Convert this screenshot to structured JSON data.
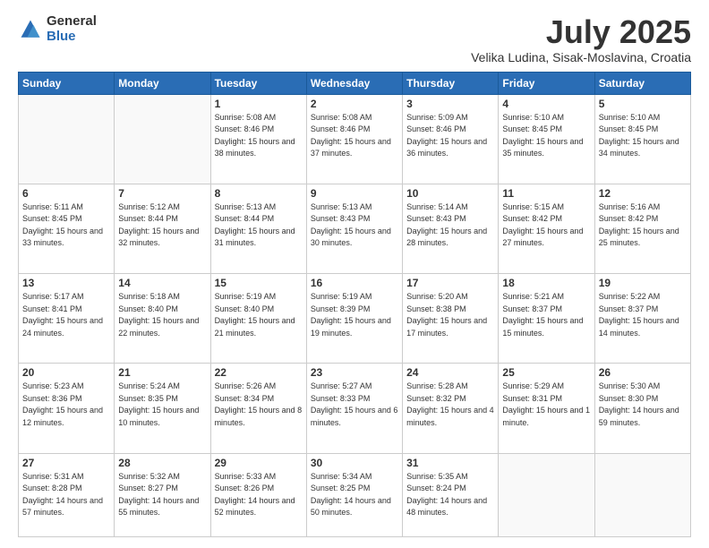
{
  "header": {
    "logo_general": "General",
    "logo_blue": "Blue",
    "month_title": "July 2025",
    "subtitle": "Velika Ludina, Sisak-Moslavina, Croatia"
  },
  "days_of_week": [
    "Sunday",
    "Monday",
    "Tuesday",
    "Wednesday",
    "Thursday",
    "Friday",
    "Saturday"
  ],
  "weeks": [
    [
      {
        "day": "",
        "sunrise": "",
        "sunset": "",
        "daylight": ""
      },
      {
        "day": "",
        "sunrise": "",
        "sunset": "",
        "daylight": ""
      },
      {
        "day": "1",
        "sunrise": "Sunrise: 5:08 AM",
        "sunset": "Sunset: 8:46 PM",
        "daylight": "Daylight: 15 hours and 38 minutes."
      },
      {
        "day": "2",
        "sunrise": "Sunrise: 5:08 AM",
        "sunset": "Sunset: 8:46 PM",
        "daylight": "Daylight: 15 hours and 37 minutes."
      },
      {
        "day": "3",
        "sunrise": "Sunrise: 5:09 AM",
        "sunset": "Sunset: 8:46 PM",
        "daylight": "Daylight: 15 hours and 36 minutes."
      },
      {
        "day": "4",
        "sunrise": "Sunrise: 5:10 AM",
        "sunset": "Sunset: 8:45 PM",
        "daylight": "Daylight: 15 hours and 35 minutes."
      },
      {
        "day": "5",
        "sunrise": "Sunrise: 5:10 AM",
        "sunset": "Sunset: 8:45 PM",
        "daylight": "Daylight: 15 hours and 34 minutes."
      }
    ],
    [
      {
        "day": "6",
        "sunrise": "Sunrise: 5:11 AM",
        "sunset": "Sunset: 8:45 PM",
        "daylight": "Daylight: 15 hours and 33 minutes."
      },
      {
        "day": "7",
        "sunrise": "Sunrise: 5:12 AM",
        "sunset": "Sunset: 8:44 PM",
        "daylight": "Daylight: 15 hours and 32 minutes."
      },
      {
        "day": "8",
        "sunrise": "Sunrise: 5:13 AM",
        "sunset": "Sunset: 8:44 PM",
        "daylight": "Daylight: 15 hours and 31 minutes."
      },
      {
        "day": "9",
        "sunrise": "Sunrise: 5:13 AM",
        "sunset": "Sunset: 8:43 PM",
        "daylight": "Daylight: 15 hours and 30 minutes."
      },
      {
        "day": "10",
        "sunrise": "Sunrise: 5:14 AM",
        "sunset": "Sunset: 8:43 PM",
        "daylight": "Daylight: 15 hours and 28 minutes."
      },
      {
        "day": "11",
        "sunrise": "Sunrise: 5:15 AM",
        "sunset": "Sunset: 8:42 PM",
        "daylight": "Daylight: 15 hours and 27 minutes."
      },
      {
        "day": "12",
        "sunrise": "Sunrise: 5:16 AM",
        "sunset": "Sunset: 8:42 PM",
        "daylight": "Daylight: 15 hours and 25 minutes."
      }
    ],
    [
      {
        "day": "13",
        "sunrise": "Sunrise: 5:17 AM",
        "sunset": "Sunset: 8:41 PM",
        "daylight": "Daylight: 15 hours and 24 minutes."
      },
      {
        "day": "14",
        "sunrise": "Sunrise: 5:18 AM",
        "sunset": "Sunset: 8:40 PM",
        "daylight": "Daylight: 15 hours and 22 minutes."
      },
      {
        "day": "15",
        "sunrise": "Sunrise: 5:19 AM",
        "sunset": "Sunset: 8:40 PM",
        "daylight": "Daylight: 15 hours and 21 minutes."
      },
      {
        "day": "16",
        "sunrise": "Sunrise: 5:19 AM",
        "sunset": "Sunset: 8:39 PM",
        "daylight": "Daylight: 15 hours and 19 minutes."
      },
      {
        "day": "17",
        "sunrise": "Sunrise: 5:20 AM",
        "sunset": "Sunset: 8:38 PM",
        "daylight": "Daylight: 15 hours and 17 minutes."
      },
      {
        "day": "18",
        "sunrise": "Sunrise: 5:21 AM",
        "sunset": "Sunset: 8:37 PM",
        "daylight": "Daylight: 15 hours and 15 minutes."
      },
      {
        "day": "19",
        "sunrise": "Sunrise: 5:22 AM",
        "sunset": "Sunset: 8:37 PM",
        "daylight": "Daylight: 15 hours and 14 minutes."
      }
    ],
    [
      {
        "day": "20",
        "sunrise": "Sunrise: 5:23 AM",
        "sunset": "Sunset: 8:36 PM",
        "daylight": "Daylight: 15 hours and 12 minutes."
      },
      {
        "day": "21",
        "sunrise": "Sunrise: 5:24 AM",
        "sunset": "Sunset: 8:35 PM",
        "daylight": "Daylight: 15 hours and 10 minutes."
      },
      {
        "day": "22",
        "sunrise": "Sunrise: 5:26 AM",
        "sunset": "Sunset: 8:34 PM",
        "daylight": "Daylight: 15 hours and 8 minutes."
      },
      {
        "day": "23",
        "sunrise": "Sunrise: 5:27 AM",
        "sunset": "Sunset: 8:33 PM",
        "daylight": "Daylight: 15 hours and 6 minutes."
      },
      {
        "day": "24",
        "sunrise": "Sunrise: 5:28 AM",
        "sunset": "Sunset: 8:32 PM",
        "daylight": "Daylight: 15 hours and 4 minutes."
      },
      {
        "day": "25",
        "sunrise": "Sunrise: 5:29 AM",
        "sunset": "Sunset: 8:31 PM",
        "daylight": "Daylight: 15 hours and 1 minute."
      },
      {
        "day": "26",
        "sunrise": "Sunrise: 5:30 AM",
        "sunset": "Sunset: 8:30 PM",
        "daylight": "Daylight: 14 hours and 59 minutes."
      }
    ],
    [
      {
        "day": "27",
        "sunrise": "Sunrise: 5:31 AM",
        "sunset": "Sunset: 8:28 PM",
        "daylight": "Daylight: 14 hours and 57 minutes."
      },
      {
        "day": "28",
        "sunrise": "Sunrise: 5:32 AM",
        "sunset": "Sunset: 8:27 PM",
        "daylight": "Daylight: 14 hours and 55 minutes."
      },
      {
        "day": "29",
        "sunrise": "Sunrise: 5:33 AM",
        "sunset": "Sunset: 8:26 PM",
        "daylight": "Daylight: 14 hours and 52 minutes."
      },
      {
        "day": "30",
        "sunrise": "Sunrise: 5:34 AM",
        "sunset": "Sunset: 8:25 PM",
        "daylight": "Daylight: 14 hours and 50 minutes."
      },
      {
        "day": "31",
        "sunrise": "Sunrise: 5:35 AM",
        "sunset": "Sunset: 8:24 PM",
        "daylight": "Daylight: 14 hours and 48 minutes."
      },
      {
        "day": "",
        "sunrise": "",
        "sunset": "",
        "daylight": ""
      },
      {
        "day": "",
        "sunrise": "",
        "sunset": "",
        "daylight": ""
      }
    ]
  ]
}
